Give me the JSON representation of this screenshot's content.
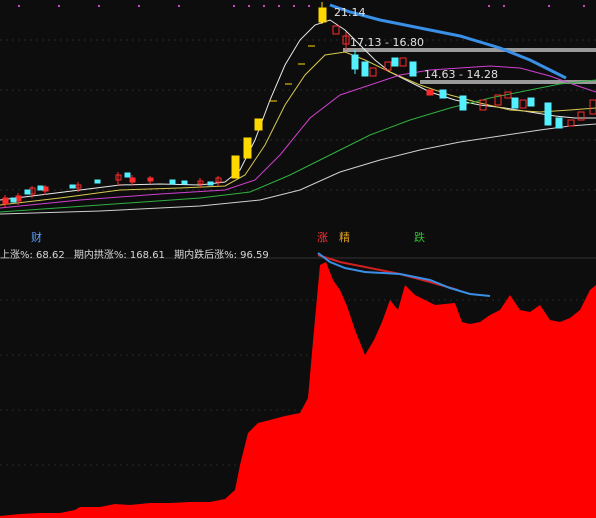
{
  "price_panel": {
    "markers": [
      "21.14",
      "17.13 - 16.80",
      "14.63 - 14.28"
    ],
    "tags": [
      {
        "text": "财",
        "color": "#5aa0ff"
      },
      {
        "text": "涨",
        "color": "#ff3030"
      },
      {
        "text": "精",
        "color": "#e0a020"
      },
      {
        "text": "跌",
        "color": "#30c030"
      }
    ]
  },
  "indicator_panel": {
    "stats": [
      "上涨%: 68.62",
      "期内拱涨%: 168.61",
      "期内跌后涨%: 96.59"
    ]
  },
  "colors": {
    "background": "#0d0d0d",
    "up_candle": "#ff2a2a",
    "down_candle": "#54f0ff",
    "highlight_candle": "#ffd800",
    "trend_line": "#3a8fe6",
    "area_fill": "#ff0000"
  }
}
